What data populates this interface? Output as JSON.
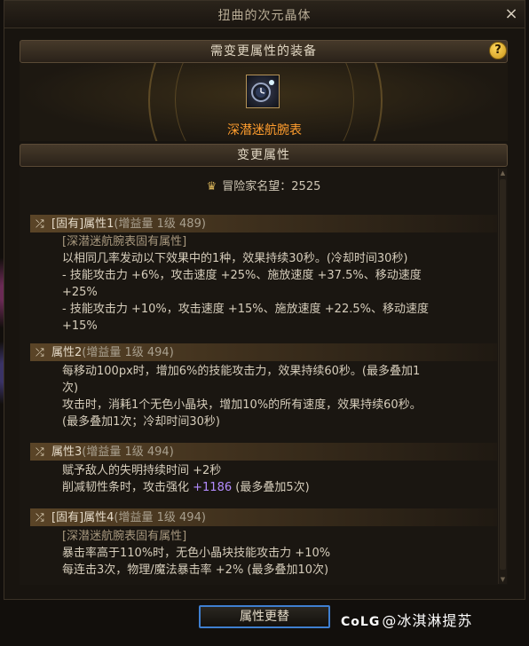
{
  "window": {
    "title": "扭曲的次元晶体",
    "close_label": "×"
  },
  "equip_section": {
    "header": "需变更属性的装备",
    "help_label": "?",
    "item_name": "深潜迷航腕表"
  },
  "change_section": {
    "header": "变更属性"
  },
  "reputation": {
    "label": "冒险家名望：",
    "value": "2525"
  },
  "attributes": [
    {
      "title": "[固有]属性1",
      "gain": "(增益量 1级 489)",
      "lines": [
        {
          "text": "[深潜迷航腕表固有属性]",
          "type": "tag"
        },
        {
          "text": "以相同几率发动以下效果中的1种，效果持续30秒。(冷却时间30秒)",
          "type": "normal"
        },
        {
          "text": "- 技能攻击力 +6%，攻击速度 +25%、施放速度 +37.5%、移动速度",
          "type": "normal"
        },
        {
          "text": "+25%",
          "type": "normal"
        },
        {
          "text": "- 技能攻击力 +10%，攻击速度 +15%、施放速度 +22.5%、移动速度",
          "type": "normal"
        },
        {
          "text": "+15%",
          "type": "normal"
        }
      ]
    },
    {
      "title": "属性2",
      "gain": "(增益量 1级 494)",
      "lines": [
        {
          "text": "每移动100px时，增加6%的技能攻击力，效果持续60秒。(最多叠加1",
          "type": "normal"
        },
        {
          "text": "次)",
          "type": "normal"
        },
        {
          "text": "攻击时，消耗1个无色小晶块，增加10%的所有速度，效果持续60秒。",
          "type": "normal"
        },
        {
          "text": "(最多叠加1次；冷却时间30秒)",
          "type": "normal"
        }
      ]
    },
    {
      "title": "属性3",
      "gain": "(增益量 1级 494)",
      "lines": [
        {
          "text": "赋予敌人的失明持续时间 +2秒",
          "type": "normal"
        },
        {
          "text_before": "削减韧性条时，攻击强化 ",
          "highlight": "+1186",
          "text_after": " (最多叠加5次)",
          "type": "mixed"
        }
      ]
    },
    {
      "title": "[固有]属性4",
      "gain": "(增益量 1级 494)",
      "lines": [
        {
          "text": "[深潜迷航腕表固有属性]",
          "type": "tag"
        },
        {
          "text": "暴击率高于110%时，无色小晶块技能攻击力 +10%",
          "type": "normal"
        },
        {
          "text": "每连击3次，物理/魔法暴击率 +2% (最多叠加10次)",
          "type": "normal"
        }
      ]
    }
  ],
  "footer": {
    "button_label": "属性更替",
    "watermark_logo": "CoLG",
    "watermark_text": "@冰淇淋提苏"
  },
  "colors": {
    "item_name": "#ff9d2e",
    "highlight": "#b48cff",
    "button_border": "#3f7fd0"
  }
}
